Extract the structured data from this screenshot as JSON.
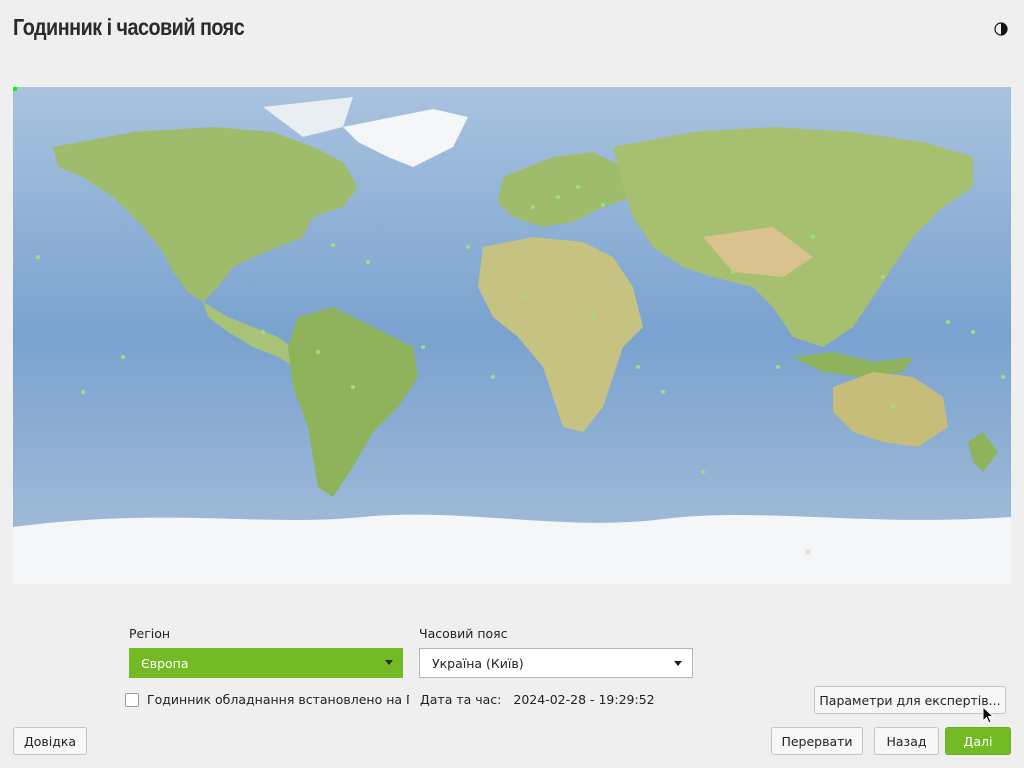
{
  "header": {
    "title": "Годинник і часовий пояс",
    "theme_icon": "half-moon-icon"
  },
  "colors": {
    "accent": "#73ba25",
    "ocean": "#7da4cf",
    "land": "#9ebc6c",
    "ice": "#f4f6f8",
    "timezone_dot": "#9be27a"
  },
  "settings": {
    "region_label": "Регіон",
    "region_value": "Європа",
    "timezone_label": "Часовий пояс",
    "timezone_value": "Україна (Київ)",
    "hw_clock_label": "Годинник обладнання встановлено на Гри",
    "datetime_label": "Дата та час:",
    "datetime_value": "2024-02-28 - 19:29:52",
    "expert_button": "Параметри для експертів..."
  },
  "footer": {
    "help": "Довідка",
    "abort": "Перервати",
    "back": "Назад",
    "next": "Далі"
  }
}
